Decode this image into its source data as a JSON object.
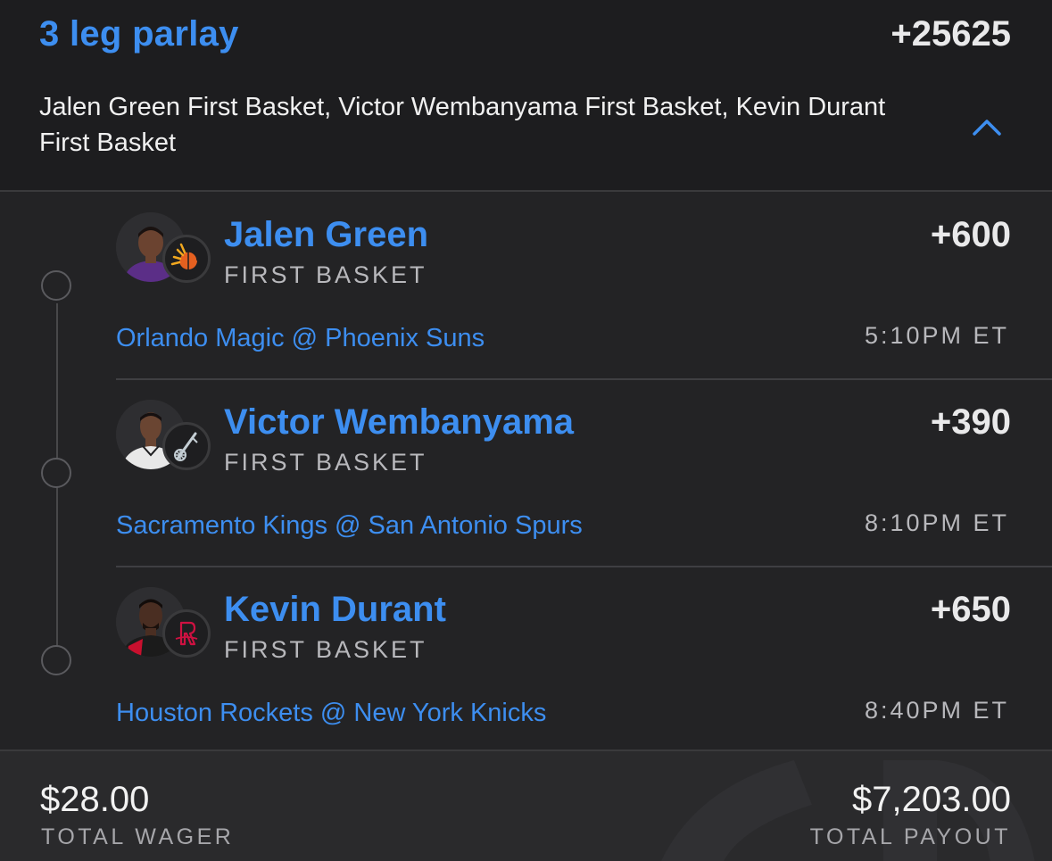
{
  "parlay": {
    "title": "3 leg parlay",
    "odds": "+25625",
    "description": "Jalen Green First Basket, Victor Wembanyama First Basket, Kevin Durant First Basket",
    "collapse_icon": "chevron-up-icon"
  },
  "legs": [
    {
      "player": "Jalen Green",
      "market": "FIRST BASKET",
      "odds": "+600",
      "matchup": "Orlando Magic @ Phoenix Suns",
      "time": "5:10PM ET",
      "team_icon": "suns-logo-icon",
      "jersey_color": "#5b2e87",
      "logo_color": "#e56020"
    },
    {
      "player": "Victor Wembanyama",
      "market": "FIRST BASKET",
      "odds": "+390",
      "matchup": "Sacramento Kings @ San Antonio Spurs",
      "time": "8:10PM ET",
      "team_icon": "spurs-logo-icon",
      "jersey_color": "#e8e8e8",
      "logo_color": "#c4ced4"
    },
    {
      "player": "Kevin Durant",
      "market": "FIRST BASKET",
      "odds": "+650",
      "matchup": "Houston Rockets @ New York Knicks",
      "time": "8:40PM ET",
      "team_icon": "rockets-logo-icon",
      "jersey_color": "#c8102e",
      "logo_color": "#ce1141"
    }
  ],
  "summary": {
    "wager_amount": "$28.00",
    "wager_label": "TOTAL WAGER",
    "payout_amount": "$7,203.00",
    "payout_label": "TOTAL PAYOUT"
  },
  "colors": {
    "accent": "#3d8ef0",
    "background": "#1d1d1f",
    "legs_background": "#232325",
    "footer_background": "#2a2a2c"
  }
}
